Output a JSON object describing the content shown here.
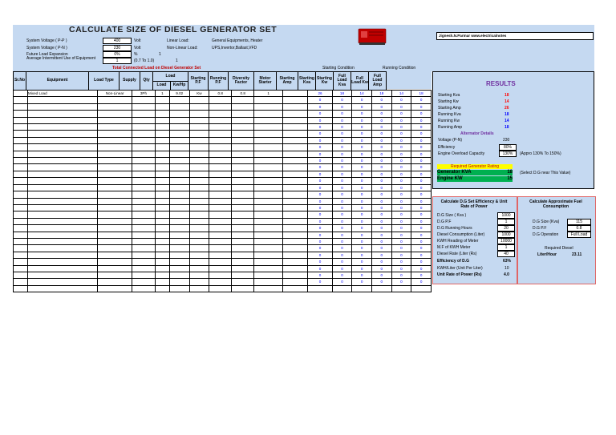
{
  "title": "CALCULATE  SIZE  OF DIESEL GENERATOR SET",
  "author": "Jignesh.N.Parmar www.electricalnotes",
  "inputs": {
    "system_voltage_pp": {
      "label": "System Voltage ( P-P )",
      "value": "400",
      "unit": "Volt"
    },
    "system_voltage_pn": {
      "label": "System Voltage ( P-N )",
      "value": "230",
      "unit": "Volt"
    },
    "future_expansion": {
      "label": "Future Load Expansion",
      "value": "0%",
      "unit": "%",
      "extra": "1"
    },
    "intermittent": {
      "label": "Average Intermittent Use of Equipment",
      "value": "1",
      "unit": "(0.7 To 1.0)",
      "extra": "1"
    }
  },
  "load_types": {
    "linear_label": "Linear Load:",
    "linear_value": "General Equipments, Heater",
    "nonlinear_label": "Non-Linear Load:",
    "nonlinear_value": "UPS,Invertor,Ballast,VFD"
  },
  "total_connected": "Total Connected Load on Diesel Generator Set",
  "group_headers": {
    "starting": "Starting Condition",
    "running": "Running Condition",
    "load": "Load"
  },
  "columns": [
    "Sr.No",
    "Equipment",
    "Load Type",
    "Supply",
    "Qty",
    "Load",
    "Kw/Hp",
    "Starting P.F",
    "Running P.F",
    "Diversity Factor",
    "Motor Starter",
    "Starting Amp",
    "Starting Kva",
    "Starting Kw",
    "Full Load Kva",
    "Full Load Kw",
    "Full Load Amp"
  ],
  "first_row": {
    "equipment": "Mixed Load",
    "load_type": "Non-Linear",
    "supply": "3Ph",
    "qty": "1",
    "load": "9.02",
    "unit": "Kw",
    "spf": "0.8",
    "rpf": "0.8",
    "div": "1",
    "starter": ""
  },
  "first_calc": [
    "26",
    "18",
    "14",
    "18",
    "14",
    "18"
  ],
  "zero": "0",
  "results": {
    "heading": "RESULTS",
    "rows": [
      {
        "label": "Starting Kva",
        "value": "18"
      },
      {
        "label": "Starting Kw",
        "value": "14"
      },
      {
        "label": "Starting Amp",
        "value": "26"
      },
      {
        "label": "Running Kva",
        "value": "18"
      },
      {
        "label": "Running Kw",
        "value": "14"
      },
      {
        "label": "Running Amp",
        "value": "18"
      }
    ],
    "alternator_heading": "Alternator Details",
    "voltage_label": "Voltage (P-N)",
    "voltage_value": "230",
    "efficiency_label": "Efficiency",
    "efficiency_value": "80%",
    "overload_label": "Engine Overload Capacity",
    "overload_value": "130%",
    "overload_note": "(Appro 130% To 150%)",
    "required_heading": "Required Generator Rating",
    "gen_kva_label": "Generator KVA",
    "gen_kva_value": "18",
    "gen_kva_note": "(Select D.G  near This Value)",
    "engine_kw_label": "Engine KW",
    "engine_kw_value": "15"
  },
  "efficiency_panel": {
    "heading": "Calculate D.G Set Efficiency & Unit Rate of Power",
    "rows": [
      {
        "label": "D.G Size ( Kva )",
        "value": "1000"
      },
      {
        "label": "D.G P.F",
        "value": "1"
      },
      {
        "label": "D.G Running Hours",
        "value": "20"
      },
      {
        "label": "Diesel Consumption (Liter)",
        "value": "1000"
      },
      {
        "label": "KWH Reading of Meter",
        "value": "10000"
      },
      {
        "label": "M.F of KWH Meter",
        "value": "1"
      },
      {
        "label": "Diesel Rate (Liter (Rs)",
        "value": "40"
      }
    ],
    "eff_label": "Efficiency of D.G",
    "eff_value": "63%",
    "kwh_label": "KWH/Liter (Unit Per Liter)",
    "kwh_value": "10",
    "unit_rate_label": "Unit Rate of Power (Rs)",
    "unit_rate_value": "4.0"
  },
  "fuel_panel": {
    "heading": "Calculate Approximate Fuel Consumption",
    "size_label": "D.G Size (Kva)",
    "size_value": "115",
    "pf_label": "D.G P.F",
    "pf_value": "0.8",
    "op_label": "D.G Operation",
    "op_value": "Full Load",
    "req_label": "Required Diesel",
    "lph_label": "Liter/Hour",
    "lph_value": "23.11"
  },
  "colors": {
    "header_blue": "#c5d9f1",
    "blue_value": "#0000ff",
    "red_value": "#ff0000",
    "yellow": "#ffff00",
    "green": "#00b050",
    "generator_red": "#c00000"
  }
}
